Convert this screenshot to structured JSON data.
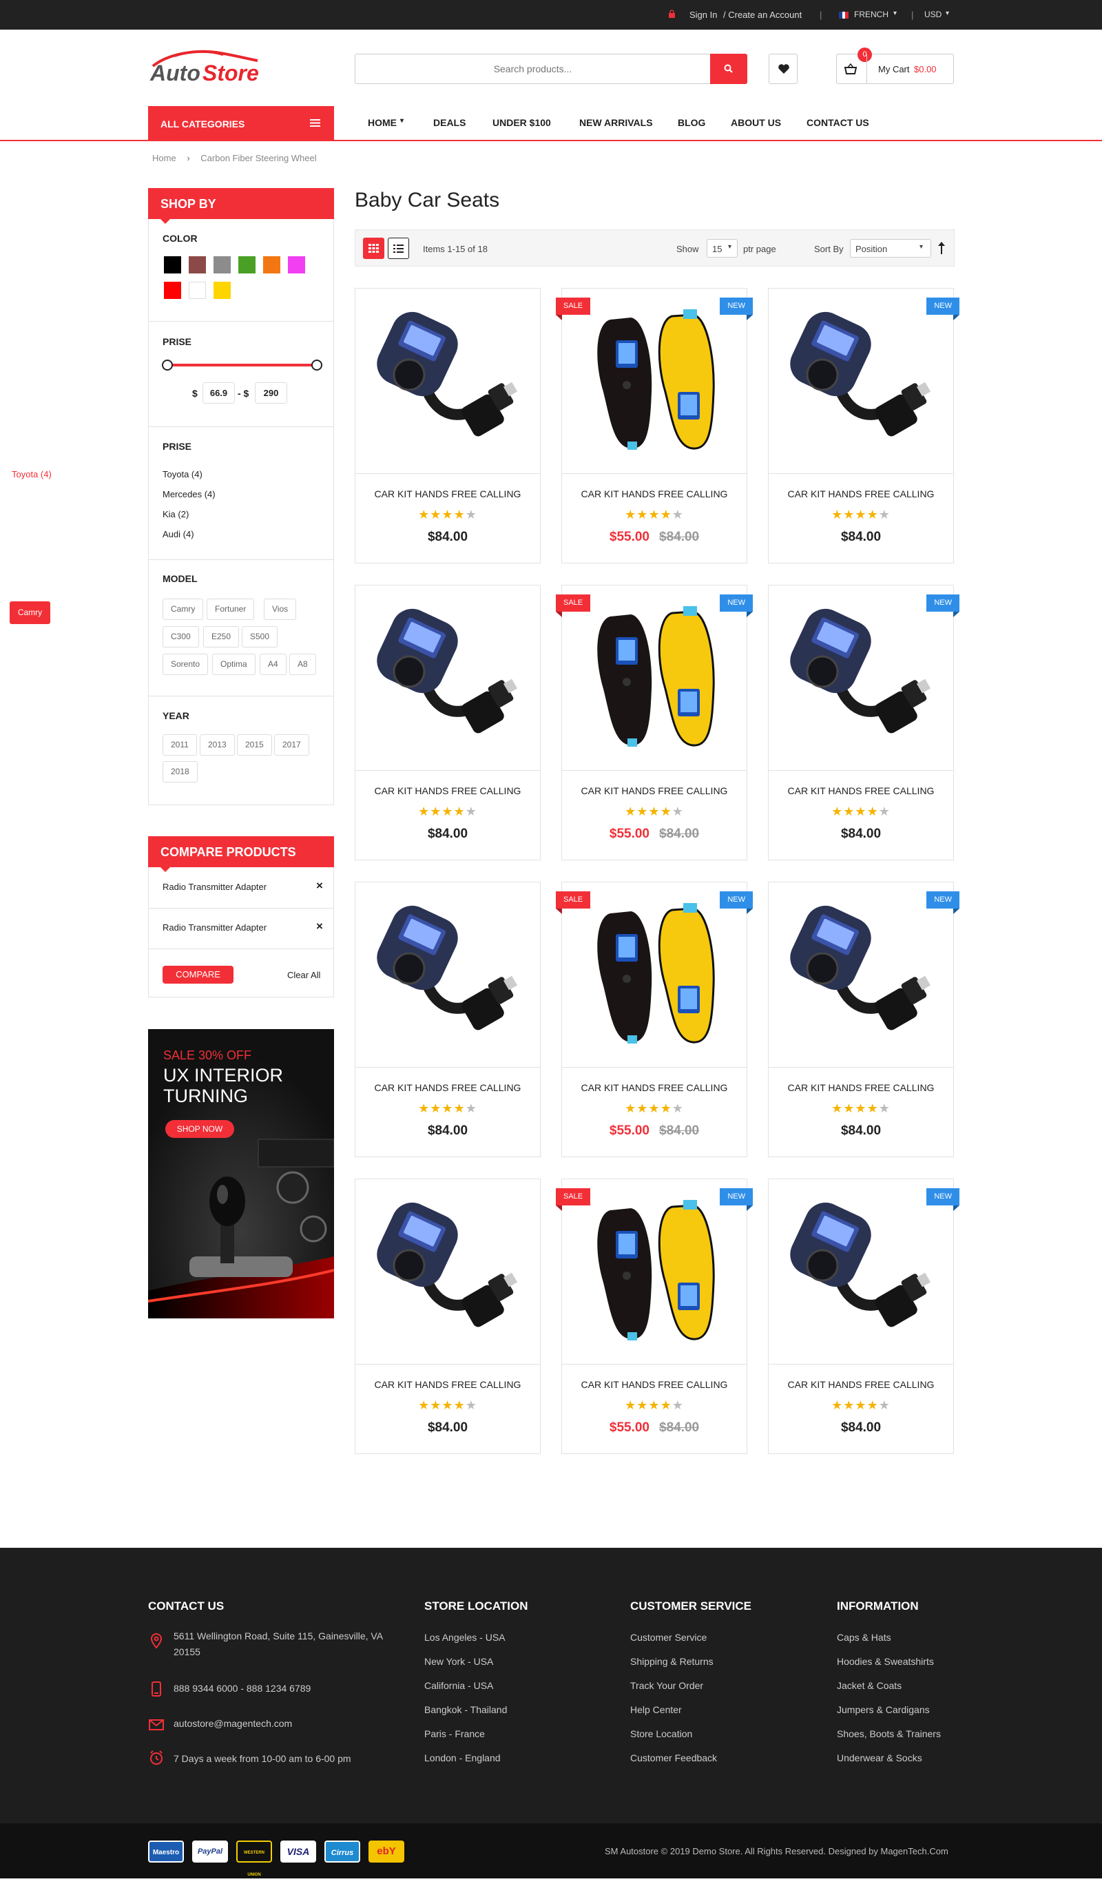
{
  "topbar": {
    "signin": "Sign In",
    "create_account": "/ Create an Account",
    "language": "FRENCH",
    "currency": "USD"
  },
  "header": {
    "logo_text_auto": "Auto",
    "logo_text_store": "Store",
    "search_placeholder": "Search products...",
    "cart_count": "0",
    "cart_label": "My Cart",
    "cart_total": "$0.00"
  },
  "nav": {
    "all_categories": "ALL CATEGORIES",
    "items": [
      "HOME",
      "DEALS",
      "UNDER $100",
      "NEW ARRIVALS",
      "BLOG",
      "ABOUT US",
      "CONTACT US"
    ]
  },
  "breadcrumb": {
    "home": "Home",
    "current": "Carbon Fiber Steering Wheel"
  },
  "sidebar": {
    "shop_by": "SHOP BY",
    "color_title": "COLOR",
    "colors": [
      "#000000",
      "#8b4a48",
      "#8c8c8c",
      "#4aa024",
      "#f27713",
      "#f23ff2",
      "#ff0000",
      "#ffffff",
      "#ffd500"
    ],
    "price_title": "PRISE",
    "price_currency": "$",
    "price_min": "66.9",
    "price_dash": "- $",
    "price_max": "290",
    "brand_title": "PRISE",
    "brands": [
      "Toyota (4)",
      "Mercedes (4)",
      "Kia (2)",
      "Audi (4)"
    ],
    "model_title": "MODEL",
    "models": [
      "Camry",
      "Fortuner",
      "Vios",
      "C300",
      "E250",
      "S500",
      "Sorento",
      "Optima",
      "A4",
      "A8"
    ],
    "year_title": "YEAR",
    "years": [
      "2011",
      "2013",
      "2015",
      "2017",
      "2018"
    ]
  },
  "compare": {
    "title": "COMPARE PRODUCTS",
    "items": [
      "Radio Transmitter Adapter",
      "Radio Transmitter Adapter"
    ],
    "compare_button": "COMPARE",
    "clear_all": "Clear All"
  },
  "banner": {
    "sale": "SALE 30% OFF",
    "line1": "UX INTERIOR",
    "line2": "TURNING",
    "cta": "SHOP NOW"
  },
  "main": {
    "title": "Baby Car Seats",
    "items_count": "Items 1-15 of 18",
    "show_label": "Show",
    "per_page": "15",
    "per_page_suffix": "ptr page",
    "sort_label": "Sort By",
    "sort_value": "Position"
  },
  "products": [
    {
      "name": "CAR KIT HANDS FREE CALLING",
      "price": "$84.00",
      "old_price": "",
      "badge": "",
      "image": "fm-transmitter"
    },
    {
      "name": "CAR KIT HANDS FREE CALLING",
      "price": "$55.00",
      "old_price": "$84.00",
      "badge": "sale-new",
      "image": "tire-gauge"
    },
    {
      "name": "CAR KIT HANDS FREE CALLING",
      "price": "$84.00",
      "old_price": "",
      "badge": "new",
      "image": "fm-transmitter"
    },
    {
      "name": "CAR KIT HANDS FREE CALLING",
      "price": "$84.00",
      "old_price": "",
      "badge": "",
      "image": "fm-transmitter"
    },
    {
      "name": "CAR KIT HANDS FREE CALLING",
      "price": "$55.00",
      "old_price": "$84.00",
      "badge": "sale-new",
      "image": "tire-gauge"
    },
    {
      "name": "CAR KIT HANDS FREE CALLING",
      "price": "$84.00",
      "old_price": "",
      "badge": "new",
      "image": "fm-transmitter"
    },
    {
      "name": "CAR KIT HANDS FREE CALLING",
      "price": "$84.00",
      "old_price": "",
      "badge": "",
      "image": "fm-transmitter"
    },
    {
      "name": "CAR KIT HANDS FREE CALLING",
      "price": "$55.00",
      "old_price": "$84.00",
      "badge": "sale-new",
      "image": "tire-gauge"
    },
    {
      "name": "CAR KIT HANDS FREE CALLING",
      "price": "$84.00",
      "old_price": "",
      "badge": "new",
      "image": "fm-transmitter"
    },
    {
      "name": "CAR KIT HANDS FREE CALLING",
      "price": "$84.00",
      "old_price": "",
      "badge": "",
      "image": "fm-transmitter"
    },
    {
      "name": "CAR KIT HANDS FREE CALLING",
      "price": "$55.00",
      "old_price": "$84.00",
      "badge": "sale-new",
      "image": "tire-gauge"
    },
    {
      "name": "CAR KIT HANDS FREE CALLING",
      "price": "$84.00",
      "old_price": "",
      "badge": "new",
      "image": "fm-transmitter"
    }
  ],
  "ratings": {
    "stars": 4,
    "max": 5
  },
  "badges": {
    "sale": "SALE",
    "new": "NEW"
  },
  "floating": {
    "toyota": "Toyota (4)",
    "camry": "Camry"
  },
  "footer": {
    "contact_title": "CONTACT US",
    "address": "5611 Wellington Road, Suite 115, Gainesville, VA 20155",
    "phone": "888 9344 6000 - 888 1234 6789",
    "email": "autostore@magentech.com",
    "hours": "7 Days a week from 10-00 am to 6-00 pm",
    "store_title": "STORE LOCATION",
    "stores": [
      "Los Angeles - USA",
      "New York - USA",
      "California - USA",
      "Bangkok - Thailand",
      "Paris - France",
      "London - England"
    ],
    "service_title": "CUSTOMER SERVICE",
    "services": [
      "Customer Service",
      "Shipping & Returns",
      "Track Your Order",
      "Help Center",
      "Store Location",
      "Customer Feedback"
    ],
    "info_title": "INFORMATION",
    "info": [
      "Caps & Hats",
      "Hoodies & Sweatshirts",
      "Jacket & Coats",
      "Jumpers & Cardigans",
      "Shoes, Boots & Trainers",
      "Underwear & Socks"
    ],
    "payments": [
      "Maestro",
      "PayPal",
      "WESTERN UNION",
      "VISA",
      "Cirrus",
      "ebY"
    ],
    "copyright": "SM Autostore © 2019 Demo Store. All Rights Reserved. Designed by MagenTech.Com"
  },
  "colors": {
    "accent": "#f22f37",
    "new_badge": "#2f8fe8",
    "star": "#f5b301",
    "footer_bg": "#1e1e1e"
  }
}
